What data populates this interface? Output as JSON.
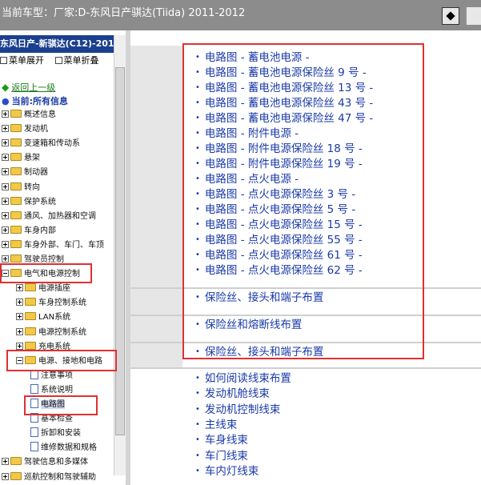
{
  "header": {
    "label": "当前车型：",
    "vendor": "厂家:D-东风日产骐达(Tiida) 2011-2012"
  },
  "left": {
    "model": "东风日产-新骐达(C12)-201",
    "expand_all": "菜单展开",
    "collapse_all": "菜单折叠",
    "back": "返回上一级",
    "current": "当前:所有信息",
    "tree": [
      {
        "label": "概述信息",
        "level": 0,
        "state": "plus"
      },
      {
        "label": "发动机",
        "level": 0,
        "state": "plus"
      },
      {
        "label": "变速箱和传动系",
        "level": 0,
        "state": "plus"
      },
      {
        "label": "悬架",
        "level": 0,
        "state": "plus"
      },
      {
        "label": "制动器",
        "level": 0,
        "state": "plus"
      },
      {
        "label": "转向",
        "level": 0,
        "state": "plus"
      },
      {
        "label": "保护系统",
        "level": 0,
        "state": "plus"
      },
      {
        "label": "通风、加热器和空调",
        "level": 0,
        "state": "plus"
      },
      {
        "label": "车身内部",
        "level": 0,
        "state": "plus"
      },
      {
        "label": "车身外部、车门、车顶",
        "level": 0,
        "state": "plus"
      },
      {
        "label": "驾驶员控制",
        "level": 0,
        "state": "plus"
      },
      {
        "label": "电气和电源控制",
        "level": 0,
        "state": "minus"
      },
      {
        "label": "电源插座",
        "level": 1,
        "state": "plus"
      },
      {
        "label": "车身控制系统",
        "level": 1,
        "state": "plus"
      },
      {
        "label": "LAN系统",
        "level": 1,
        "state": "plus"
      },
      {
        "label": "电源控制系统",
        "level": 1,
        "state": "plus"
      },
      {
        "label": "充电系统",
        "level": 1,
        "state": "plus"
      },
      {
        "label": "电源、接地和电路",
        "level": 1,
        "state": "minus"
      },
      {
        "label": "注意事项",
        "level": 2,
        "state": "doc"
      },
      {
        "label": "系统说明",
        "level": 2,
        "state": "doc"
      },
      {
        "label": "电路图",
        "level": 2,
        "state": "doc"
      },
      {
        "label": "基本检查",
        "level": 2,
        "state": "doc"
      },
      {
        "label": "拆卸和安装",
        "level": 2,
        "state": "doc"
      },
      {
        "label": "维修数据和规格",
        "level": 2,
        "state": "doc"
      },
      {
        "label": "驾驶信息和多媒体",
        "level": 0,
        "state": "plus"
      },
      {
        "label": "巡航控制和驾驶辅助",
        "level": 0,
        "state": "plus"
      }
    ]
  },
  "content": {
    "group1": [
      "电路图 - 蓄电池电源 -",
      "电路图 - 蓄电池电源保险丝 9 号 -",
      "电路图 - 蓄电池电源保险丝 13 号 -",
      "电路图 - 蓄电池电源保险丝 43 号 -",
      "电路图 - 蓄电池电源保险丝 47 号 -",
      "电路图 - 附件电源 -",
      "电路图 - 附件电源保险丝 18 号 -",
      "电路图 - 附件电源保险丝 19 号 -",
      "电路图 - 点火电源 -",
      "电路图 - 点火电源保险丝 3 号 -",
      "电路图 - 点火电源保险丝 5 号 -",
      "电路图 - 点火电源保险丝 15 号 -",
      "电路图 - 点火电源保险丝 55 号 -",
      "电路图 - 点火电源保险丝 61 号 -",
      "电路图 - 点火电源保险丝 62 号 -"
    ],
    "group2": [
      "保险丝、接头和端子布置"
    ],
    "group3": [
      "保险丝和熔断线布置"
    ],
    "group4": [
      "保险丝、接头和端子布置"
    ],
    "group5": [
      "如何阅读线束布置",
      "发动机舱线束",
      "发动机控制线束",
      "主线束",
      "车身线束",
      "车门线束",
      "车内灯线束"
    ]
  },
  "colors": {
    "link": "#1a3aa8",
    "header": "#8c8c8c",
    "sidebar_title": "#1b3f8f",
    "highlight": "#e03030"
  }
}
